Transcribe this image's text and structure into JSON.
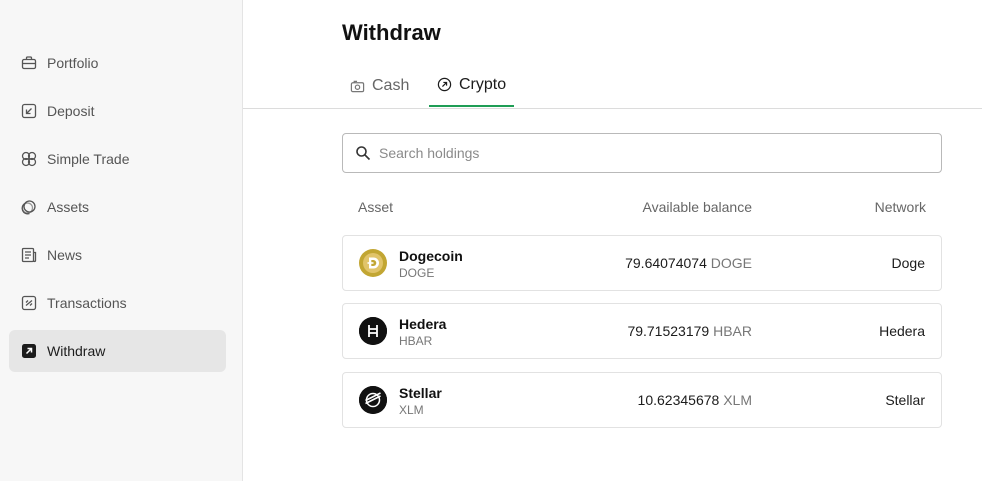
{
  "sidebar": {
    "items": [
      {
        "label": "Portfolio",
        "icon": "briefcase-icon"
      },
      {
        "label": "Deposit",
        "icon": "deposit-arrow-icon"
      },
      {
        "label": "Simple Trade",
        "icon": "simple-trade-icon"
      },
      {
        "label": "Assets",
        "icon": "assets-icon"
      },
      {
        "label": "News",
        "icon": "news-icon"
      },
      {
        "label": "Transactions",
        "icon": "transactions-icon"
      },
      {
        "label": "Withdraw",
        "icon": "withdraw-arrow-icon",
        "active": true
      }
    ]
  },
  "header": {
    "title": "Withdraw"
  },
  "tabs": [
    {
      "label": "Cash",
      "icon": "cash-icon",
      "active": false
    },
    {
      "label": "Crypto",
      "icon": "crypto-arrow-icon",
      "active": true
    }
  ],
  "search": {
    "placeholder": "Search holdings",
    "value": ""
  },
  "table": {
    "headers": {
      "asset": "Asset",
      "balance": "Available balance",
      "network": "Network"
    },
    "rows": [
      {
        "name": "Dogecoin",
        "symbol": "DOGE",
        "amount": "79.64074074",
        "unit": "DOGE",
        "network": "Doge",
        "icon": "dogecoin-icon",
        "icon_color": "#c2a633"
      },
      {
        "name": "Hedera",
        "symbol": "HBAR",
        "amount": "79.71523179",
        "unit": "HBAR",
        "network": "Hedera",
        "icon": "hedera-icon",
        "icon_color": "#111111"
      },
      {
        "name": "Stellar",
        "symbol": "XLM",
        "amount": "10.62345678",
        "unit": "XLM",
        "network": "Stellar",
        "icon": "stellar-icon",
        "icon_color": "#111111"
      }
    ]
  },
  "colors": {
    "accent": "#1f9d55",
    "sidebar_bg": "#f7f7f7",
    "active_item_bg": "#e6e6e6"
  }
}
